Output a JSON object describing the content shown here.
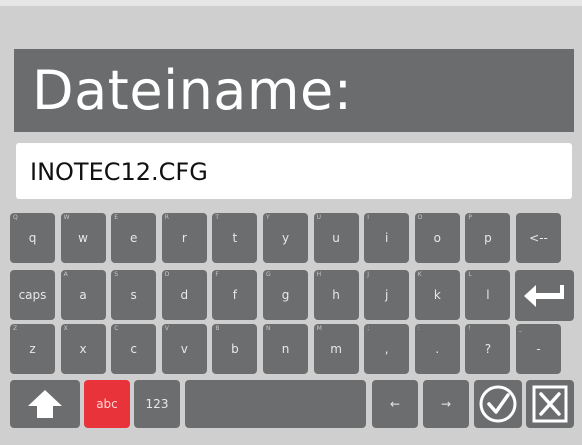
{
  "title": "Dateiname:",
  "filename_value": "INOTEC12.CFG",
  "colors": {
    "key_bg": "#6b6d6f",
    "active": "#e8333a",
    "background": "#cfcfcf"
  },
  "rows": [
    [
      {
        "label": "q",
        "sub": "Q"
      },
      {
        "label": "w",
        "sub": "W"
      },
      {
        "label": "e",
        "sub": "E"
      },
      {
        "label": "r",
        "sub": "R"
      },
      {
        "label": "t",
        "sub": "T"
      },
      {
        "label": "y",
        "sub": "Y"
      },
      {
        "label": "u",
        "sub": "U"
      },
      {
        "label": "i",
        "sub": "I"
      },
      {
        "label": "o",
        "sub": "O"
      },
      {
        "label": "p",
        "sub": "P"
      },
      {
        "label": "<--",
        "sub": ""
      }
    ],
    [
      {
        "label": "caps",
        "sub": ""
      },
      {
        "label": "a",
        "sub": "A"
      },
      {
        "label": "s",
        "sub": "S"
      },
      {
        "label": "d",
        "sub": "D"
      },
      {
        "label": "f",
        "sub": "F"
      },
      {
        "label": "g",
        "sub": "G"
      },
      {
        "label": "h",
        "sub": "H"
      },
      {
        "label": "j",
        "sub": "J"
      },
      {
        "label": "k",
        "sub": "K"
      },
      {
        "label": "l",
        "sub": "L"
      }
    ],
    [
      {
        "label": "z",
        "sub": "Z"
      },
      {
        "label": "x",
        "sub": "X"
      },
      {
        "label": "c",
        "sub": "C"
      },
      {
        "label": "v",
        "sub": "V"
      },
      {
        "label": "b",
        "sub": "B"
      },
      {
        "label": "n",
        "sub": "N"
      },
      {
        "label": "m",
        "sub": "M"
      },
      {
        "label": ",",
        "sub": ";"
      },
      {
        "label": ".",
        "sub": ":"
      },
      {
        "label": "?",
        "sub": "!"
      },
      {
        "label": "-",
        "sub": "_"
      }
    ]
  ],
  "bottom": {
    "abc_label": "abc",
    "num_label": "123",
    "left_arrow": "←",
    "right_arrow": "→"
  },
  "icons": {
    "shift": "shift-icon",
    "enter": "enter-icon",
    "confirm": "check-circle-icon",
    "cancel": "close-box-icon"
  }
}
